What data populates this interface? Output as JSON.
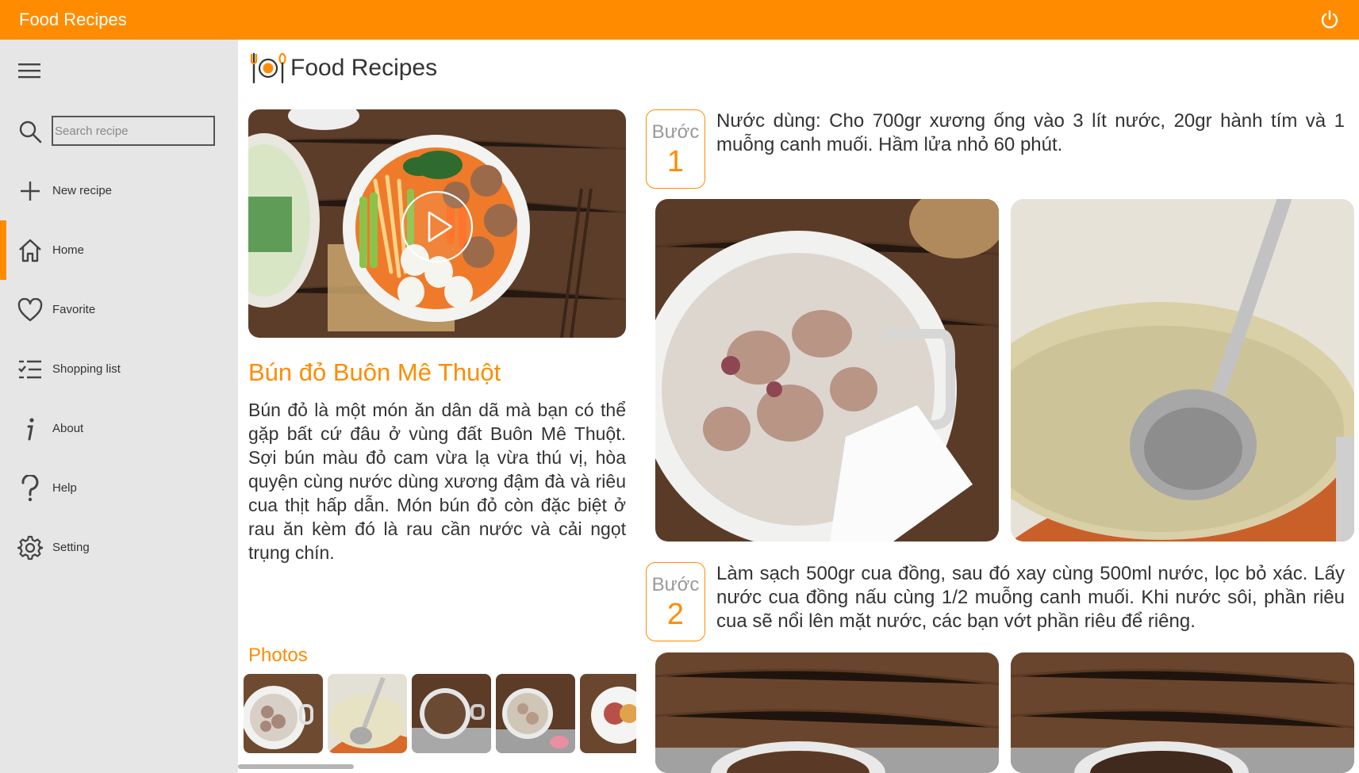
{
  "window": {
    "title": "Food Recipes"
  },
  "sidebar": {
    "search_placeholder": "Search recipe",
    "items": [
      {
        "label": "New recipe",
        "icon": "plus-icon"
      },
      {
        "label": "Home",
        "icon": "home-icon",
        "active": true
      },
      {
        "label": "Favorite",
        "icon": "heart-icon"
      },
      {
        "label": "Shopping list",
        "icon": "checklist-icon"
      },
      {
        "label": "About",
        "icon": "info-icon"
      },
      {
        "label": "Help",
        "icon": "question-icon"
      },
      {
        "label": "Setting",
        "icon": "gear-icon"
      }
    ]
  },
  "header": {
    "title": "Food Recipes",
    "logo": "fork-plate-spoon-icon"
  },
  "recipe": {
    "title": "Bún đỏ Buôn Mê Thuột",
    "description": "Bún đỏ là một món ăn dân dã mà bạn có thể gặp bất cứ đâu ở vùng đất Buôn Mê Thuột. Sợi bún màu đỏ cam vừa lạ vừa thú vị, hòa quyện cùng nước dùng xương đậm đà và riêu cua thịt hấp dẫn. Món bún đỏ còn đặc biệt ở rau ăn kèm đó là rau cần nước và cải ngọt trụng chín.",
    "photos_label": "Photos"
  },
  "steps": [
    {
      "word": "Bước",
      "number": "1",
      "text": "Nước dùng: Cho 700gr xương ống vào 3 lít nước, 20gr hành tím và 1 muỗng canh muối. Hầm lửa nhỏ 60 phút."
    },
    {
      "word": "Bước",
      "number": "2",
      "text": "Làm sạch 500gr cua đồng, sau đó xay cùng 500ml nước, lọc bỏ xác. Lấy nước cua đồng nấu cùng 1/2 muỗng canh muối. Khi nước sôi, phần riêu cua sẽ nổi lên mặt nước, các bạn vớt phần riêu để riêng."
    }
  ],
  "colors": {
    "accent": "#ff8c00",
    "sidebar_bg": "#e6e6e6",
    "wood": "#6b4a33"
  }
}
